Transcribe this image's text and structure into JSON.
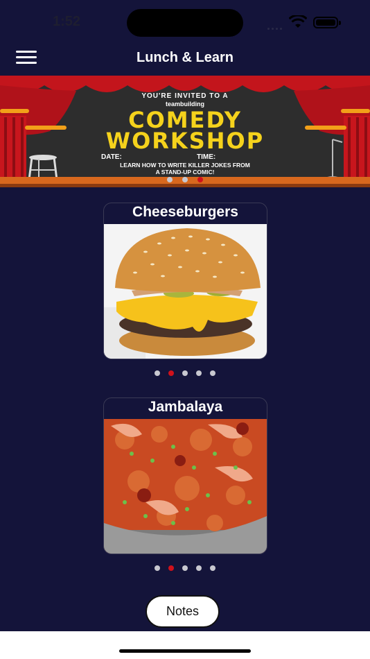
{
  "status_bar": {
    "time": "1:52",
    "icons": [
      "signal-icon",
      "wifi-icon",
      "battery-icon"
    ]
  },
  "header": {
    "title": "Lunch & Learn",
    "menu_icon": "hamburger-menu-icon"
  },
  "banner": {
    "invite": "YOU'RE INVITED TO A",
    "subtitle": "teambuilding",
    "headline_1": "COMEDY",
    "headline_2": "WORKSHOP",
    "date_label": "DATE:",
    "time_label": "TIME:",
    "learn_line_1": "LEARN HOW TO WRITE KILLER JOKES FROM",
    "learn_line_2": "A STAND-UP COMIC!",
    "pager": {
      "count": 3,
      "active_index": 2
    }
  },
  "cards": [
    {
      "title": "Cheeseburgers",
      "image": "cheeseburger-photo",
      "pager": {
        "count": 5,
        "active_index": 1
      }
    },
    {
      "title": "Jambalaya",
      "image": "jambalaya-photo",
      "pager": {
        "count": 5,
        "active_index": 1
      }
    }
  ],
  "notes_button": {
    "label": "Notes"
  },
  "colors": {
    "background": "#14143a",
    "accent_red": "#d0111b",
    "banner_yellow": "#f5d21c",
    "dot_inactive": "#c8c8d0"
  }
}
